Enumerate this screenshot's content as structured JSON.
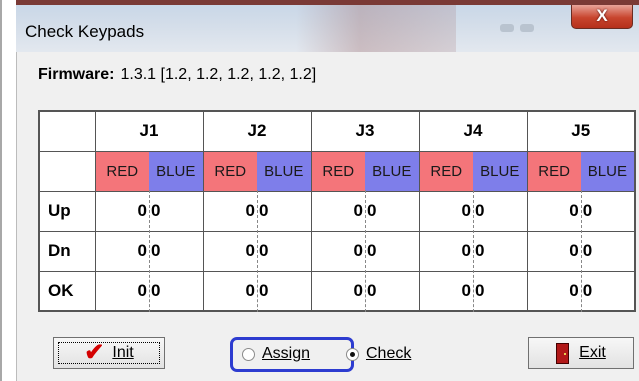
{
  "window": {
    "title": "Check Keypads",
    "close_label": "X"
  },
  "firmware": {
    "label": "Firmware:",
    "value": "1.3.1 [1.2, 1.2, 1.2, 1.2, 1.2]"
  },
  "table": {
    "columns": [
      "J1",
      "J2",
      "J3",
      "J4",
      "J5"
    ],
    "sub_labels": {
      "red": "RED",
      "blue": "BLUE"
    },
    "rows": [
      {
        "label": "Up",
        "values": [
          [
            "0",
            "0"
          ],
          [
            "0",
            "0"
          ],
          [
            "0",
            "0"
          ],
          [
            "0",
            "0"
          ],
          [
            "0",
            "0"
          ]
        ]
      },
      {
        "label": "Dn",
        "values": [
          [
            "0",
            "0"
          ],
          [
            "0",
            "0"
          ],
          [
            "0",
            "0"
          ],
          [
            "0",
            "0"
          ],
          [
            "0",
            "0"
          ]
        ]
      },
      {
        "label": "OK",
        "values": [
          [
            "0",
            "0"
          ],
          [
            "0",
            "0"
          ],
          [
            "0",
            "0"
          ],
          [
            "0",
            "0"
          ],
          [
            "0",
            "0"
          ]
        ]
      }
    ],
    "colors": {
      "red": "#f4757a",
      "blue": "#7e7eea"
    }
  },
  "buttons": {
    "init_label": "Init",
    "exit_label": "Exit"
  },
  "mode": {
    "assign_label": "Assign",
    "check_label": "Check",
    "selected": "Check"
  },
  "colors": {
    "highlight_box": "#2d3cd0",
    "check_icon": "#d40000"
  }
}
